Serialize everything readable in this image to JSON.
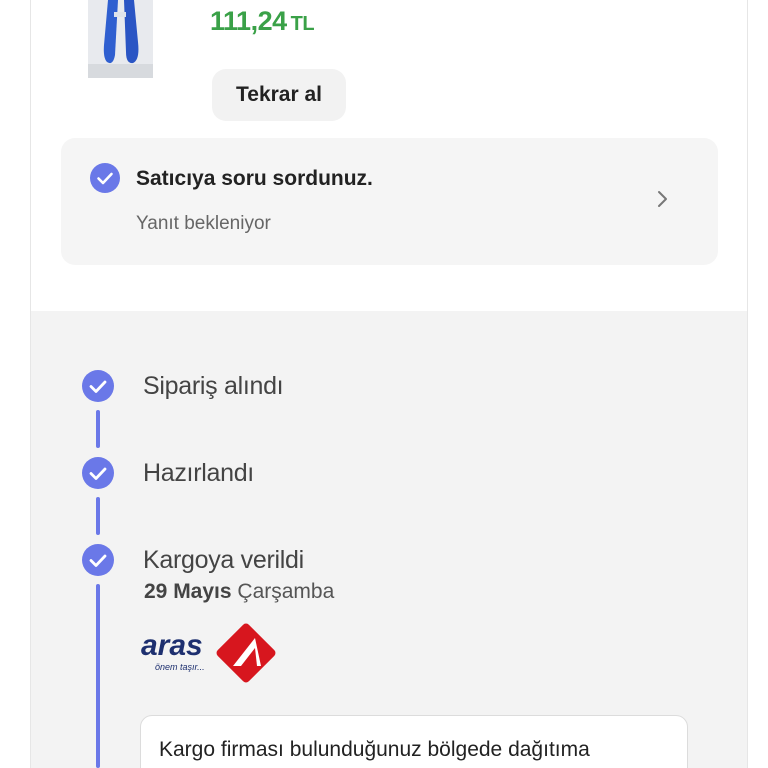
{
  "product": {
    "price_value": "111,24",
    "price_currency": "TL",
    "price_color": "#3aa148"
  },
  "reorder_button": {
    "label": "Tekrar al"
  },
  "seller_question": {
    "title": "Satıcıya soru sordunuz.",
    "status": "Yanıt bekleniyor"
  },
  "tracking": {
    "accent_color": "#6a78e8",
    "steps": [
      {
        "title": "Sipariş alındı"
      },
      {
        "title": "Hazırlandı"
      },
      {
        "title": "Kargoya verildi",
        "date_bold": "29 Mayıs",
        "date_day": "Çarşamba"
      }
    ],
    "carrier": {
      "name": "aras",
      "tagline": "önem taşır..."
    },
    "info_message": "Kargo firması bulunduğunuz bölgede dağıtıma"
  }
}
